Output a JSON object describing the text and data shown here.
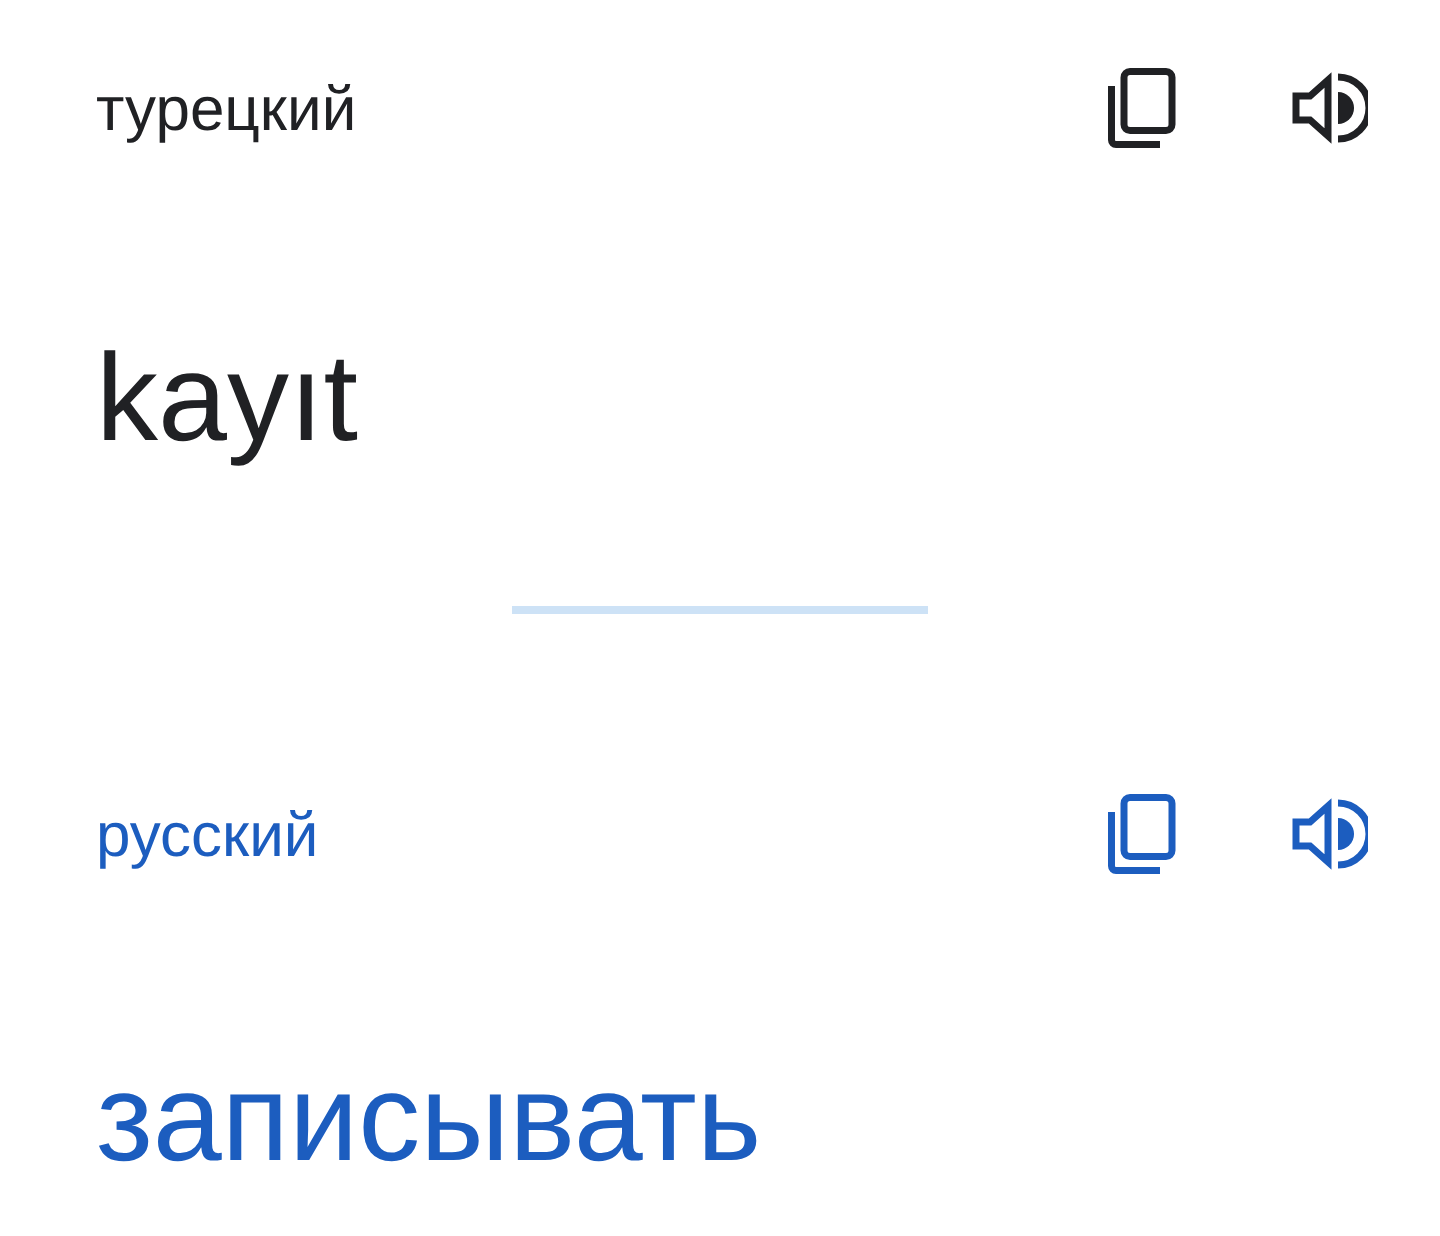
{
  "panels": [
    {
      "kind": "source",
      "language": "турецкий",
      "text": "kayıt"
    },
    {
      "kind": "target",
      "language": "русский",
      "text": "записывать"
    }
  ]
}
